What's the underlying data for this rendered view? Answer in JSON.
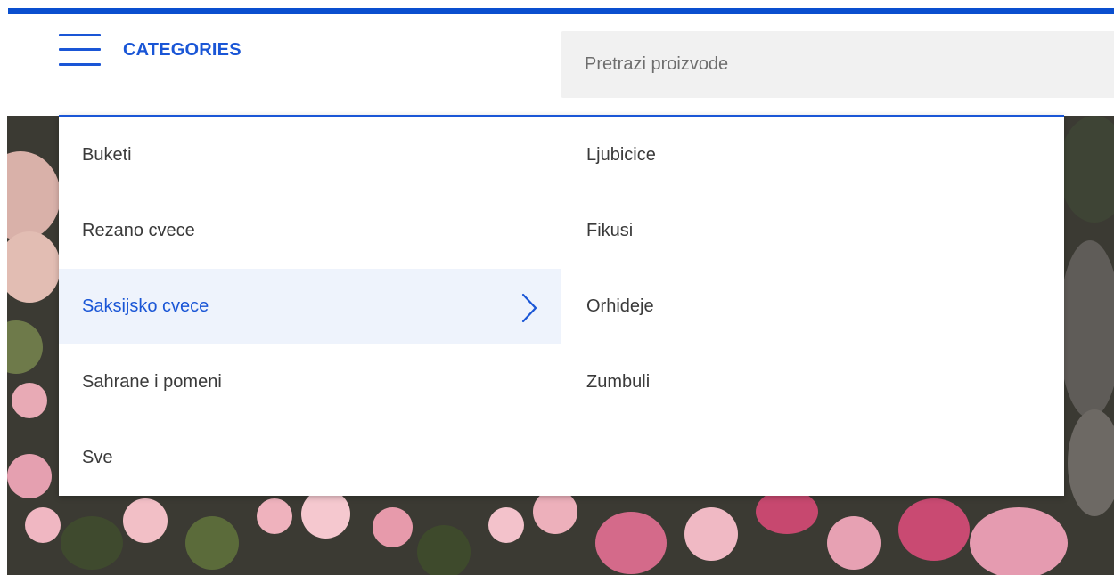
{
  "header": {
    "categories_label": "CATEGORIES",
    "search_placeholder": "Pretrazi proizvode"
  },
  "menu": {
    "categories": [
      {
        "label": "Buketi",
        "active": false
      },
      {
        "label": "Rezano cvece",
        "active": false
      },
      {
        "label": "Saksijsko cvece",
        "active": true
      },
      {
        "label": "Sahrane i pomeni",
        "active": false
      },
      {
        "label": "Sve",
        "active": false
      }
    ],
    "subcategories": [
      {
        "label": "Ljubicice"
      },
      {
        "label": "Fikusi"
      },
      {
        "label": "Orhideje"
      },
      {
        "label": "Zumbuli"
      }
    ]
  },
  "icons": {
    "menu": "hamburger-menu-icon",
    "chevron": "chevron-right-icon"
  },
  "colors": {
    "accent": "#1a56d6",
    "top_bar": "#0a4fcf",
    "active_bg": "#eef3fc",
    "search_bg": "#f1f1f1"
  }
}
